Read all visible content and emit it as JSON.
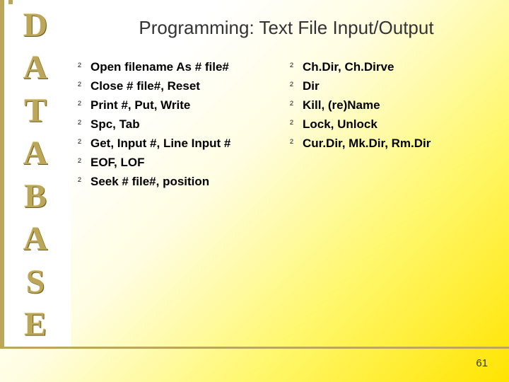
{
  "sidebar": {
    "letters": [
      "D",
      "A",
      "T",
      "A",
      "B",
      "A",
      "S",
      "E"
    ]
  },
  "title": "Programming: Text File Input/Output",
  "bullet_glyph": "²",
  "left_items": [
    "Open filename As # file#",
    "Close # file#, Reset",
    "Print #, Put, Write",
    "Spc, Tab",
    "Get, Input #, Line Input #",
    "EOF, LOF",
    "Seek # file#, position"
  ],
  "right_items": [
    "Ch.Dir, Ch.Dirve",
    "Dir",
    "Kill, (re)Name",
    "Lock, Unlock",
    "Cur.Dir, Mk.Dir, Rm.Dir"
  ],
  "page_number": "61"
}
